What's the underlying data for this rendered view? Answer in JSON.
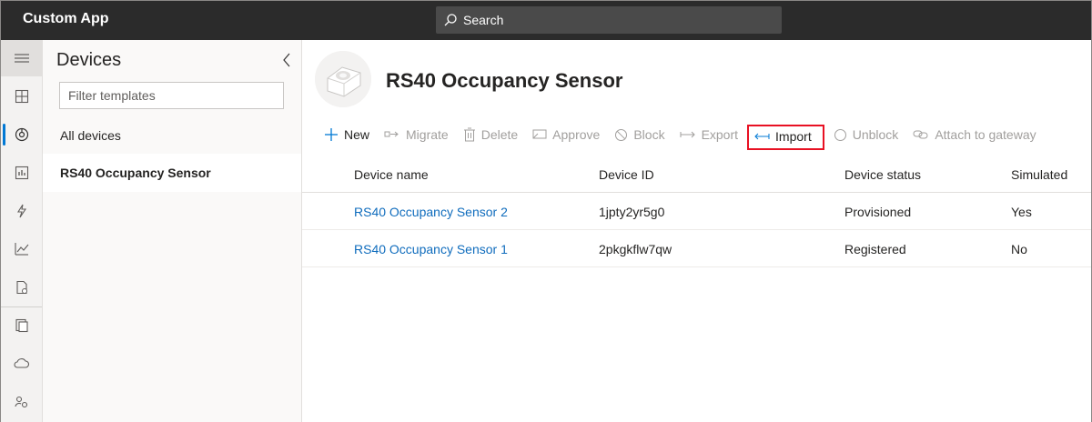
{
  "app": {
    "title": "Custom App"
  },
  "search": {
    "label": "Search"
  },
  "rail": {
    "items": [
      {
        "icon": "hamburger-icon"
      },
      {
        "icon": "dashboard-icon"
      },
      {
        "icon": "devices-icon",
        "active": true
      },
      {
        "icon": "device-groups-icon"
      },
      {
        "icon": "rules-icon"
      },
      {
        "icon": "analytics-icon"
      },
      {
        "icon": "jobs-icon"
      },
      {
        "icon": "device-templates-icon"
      },
      {
        "icon": "data-export-icon"
      },
      {
        "icon": "administration-icon"
      }
    ]
  },
  "templates": {
    "title": "Devices",
    "filter_placeholder": "Filter templates",
    "items": [
      "All devices",
      "RS40 Occupancy Sensor"
    ]
  },
  "device": {
    "title": "RS40 Occupancy Sensor"
  },
  "toolbar": {
    "new": "New",
    "migrate": "Migrate",
    "delete": "Delete",
    "approve": "Approve",
    "block": "Block",
    "export": "Export",
    "import": "Import",
    "unblock": "Unblock",
    "attach": "Attach to gateway"
  },
  "grid": {
    "columns": [
      "Device name",
      "Device ID",
      "Device status",
      "Simulated"
    ],
    "rows": [
      {
        "name": "RS40 Occupancy Sensor 2",
        "id": "1jpty2yr5g0",
        "status": "Provisioned",
        "simulated": "Yes"
      },
      {
        "name": "RS40 Occupancy Sensor 1",
        "id": "2pkgkflw7qw",
        "status": "Registered",
        "simulated": "No"
      }
    ]
  },
  "colors": {
    "accent": "#0078d4",
    "link": "#0f6cbd",
    "highlight": "#e81123",
    "topbar": "#2b2b2b"
  }
}
